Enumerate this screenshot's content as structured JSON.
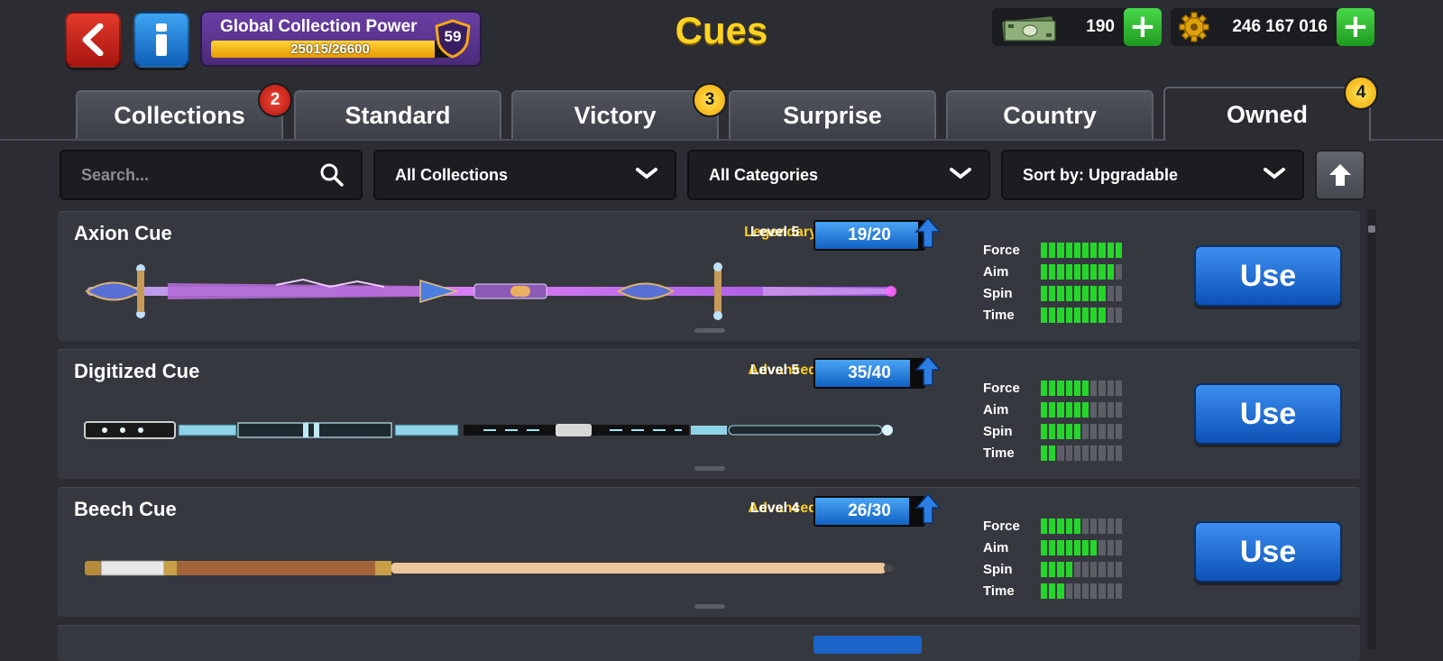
{
  "header": {
    "title": "Cues",
    "global_collection_power": {
      "label": "Global Collection Power",
      "current": 25015,
      "max": 26600,
      "text": "25015/26600",
      "level": "59"
    },
    "currencies": [
      {
        "name": "cash",
        "icon": "cash-icon",
        "value": "190"
      },
      {
        "name": "coins",
        "icon": "gear-coin-icon",
        "value": "246 167 016"
      }
    ]
  },
  "tabs": [
    {
      "label": "Collections",
      "badge": "2",
      "badge_color": "#d8231a",
      "active": false
    },
    {
      "label": "Standard",
      "badge": "",
      "active": false
    },
    {
      "label": "Victory",
      "badge": "3",
      "badge_color": "#f4b400",
      "active": false
    },
    {
      "label": "Surprise",
      "badge": "",
      "active": false
    },
    {
      "label": "Country",
      "badge": "",
      "active": false
    },
    {
      "label": "Owned",
      "badge": "4",
      "badge_color": "#f4b400",
      "active": true
    }
  ],
  "filters": {
    "search_placeholder": "Search...",
    "collections": "All Collections",
    "categories": "All Categories",
    "sort": "Sort by: Upgradable"
  },
  "cues": [
    {
      "name": "Axion Cue",
      "rarity": "Legendary",
      "level": "Level 5",
      "progress": "19/20",
      "progress_current": 19,
      "progress_max": 20,
      "stats": {
        "Force": 10,
        "Aim": 9,
        "Spin": 8,
        "Time": 8
      },
      "button": "Use"
    },
    {
      "name": "Digitized Cue",
      "rarity": "Advanced",
      "level": "Level 5",
      "progress": "35/40",
      "progress_current": 35,
      "progress_max": 40,
      "stats": {
        "Force": 6,
        "Aim": 6,
        "Spin": 5,
        "Time": 2
      },
      "button": "Use"
    },
    {
      "name": "Beech Cue",
      "rarity": "Advanced",
      "level": "Level 4",
      "progress": "26/30",
      "progress_current": 26,
      "progress_max": 30,
      "stats": {
        "Force": 5,
        "Aim": 7,
        "Spin": 4,
        "Time": 3
      },
      "button": "Use"
    }
  ],
  "stat_max": 10,
  "colors": {
    "accent_yellow": "#ffd324",
    "rarity": "#ffcf1f",
    "stat_on": "#25d62a",
    "stat_off": "#5c5f66",
    "use_button": "#1f6fd6",
    "gcp_panel": "#5b3590"
  }
}
